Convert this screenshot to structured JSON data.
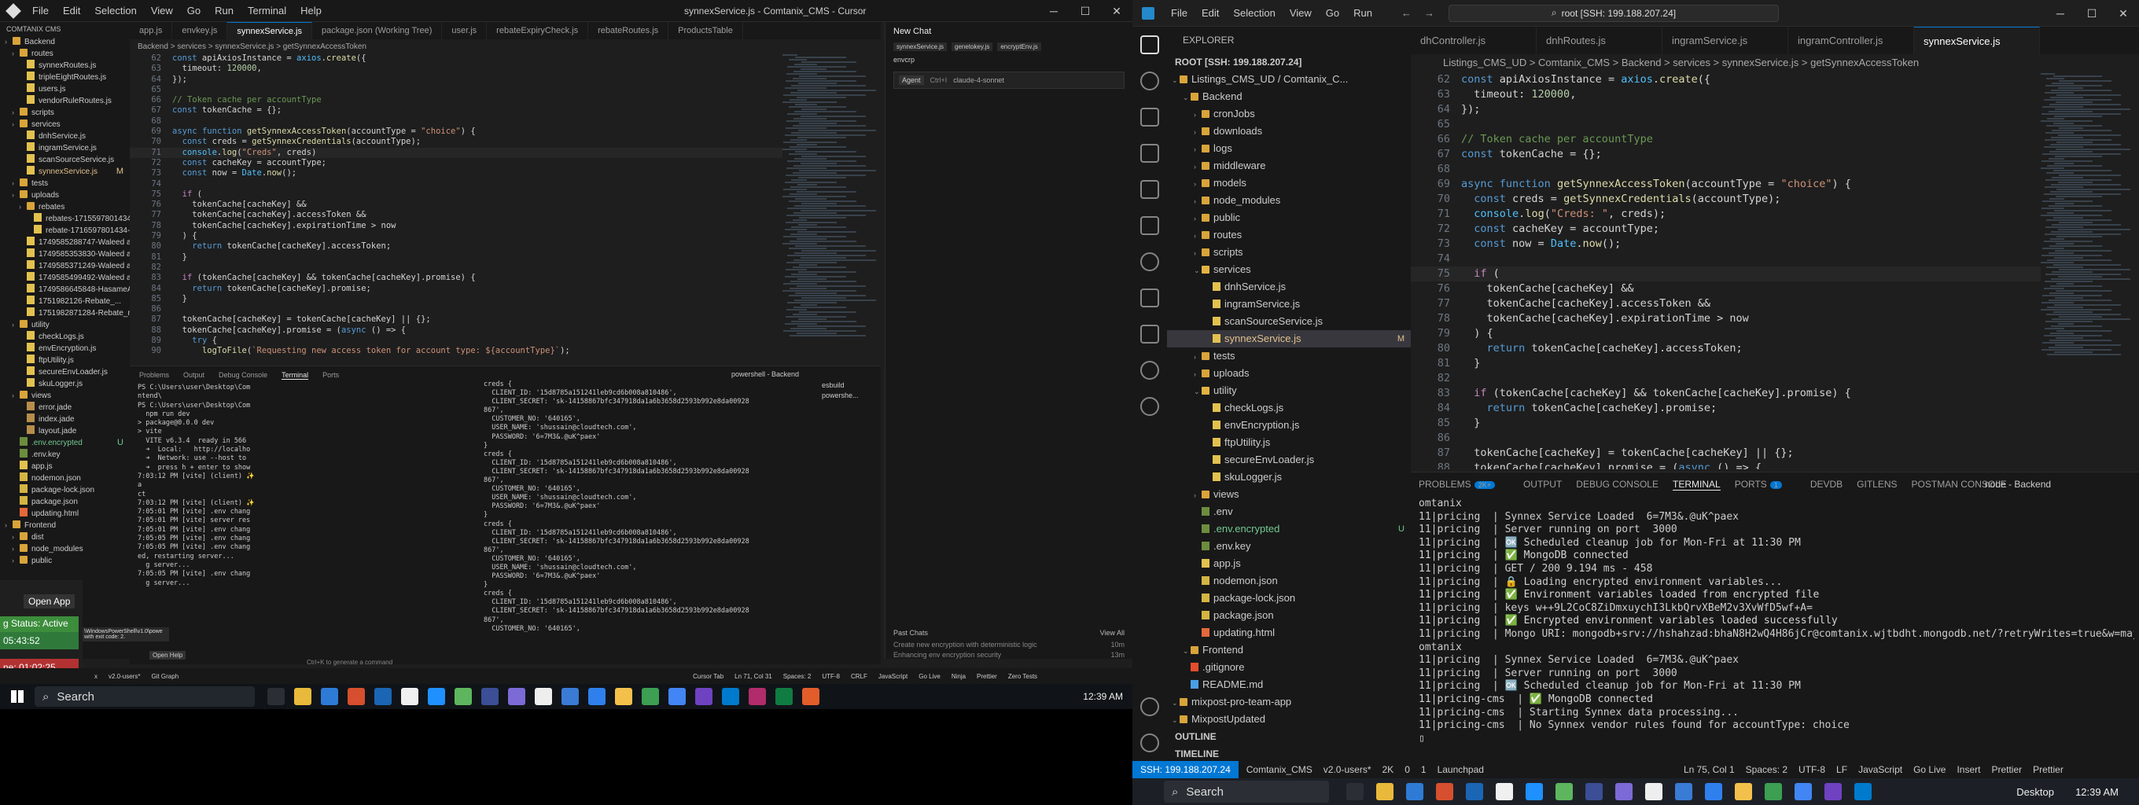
{
  "left": {
    "title": "synnexService.js - Comtanix_CMS - Cursor",
    "menu": [
      "File",
      "Edit",
      "Selection",
      "View",
      "Go",
      "Run",
      "Terminal",
      "Help"
    ],
    "explorer_title": "COMTANIX CMS",
    "tree": [
      {
        "t": "folder",
        "n": "Backend",
        "d": 0
      },
      {
        "t": "folder",
        "n": "routes",
        "d": 1
      },
      {
        "t": "file",
        "n": "synnexRoutes.js",
        "d": 2
      },
      {
        "t": "file",
        "n": "tripleEightRoutes.js",
        "d": 2
      },
      {
        "t": "file",
        "n": "users.js",
        "d": 2
      },
      {
        "t": "file",
        "n": "vendorRuleRoutes.js",
        "d": 2
      },
      {
        "t": "folder",
        "n": "scripts",
        "d": 1
      },
      {
        "t": "folder",
        "n": "services",
        "d": 1
      },
      {
        "t": "file",
        "n": "dnhService.js",
        "d": 2
      },
      {
        "t": "file",
        "n": "ingramService.js",
        "d": 2
      },
      {
        "t": "file",
        "n": "scanSourceService.js",
        "d": 2
      },
      {
        "t": "file",
        "n": "synnexService.js",
        "d": 2,
        "tag": "M"
      },
      {
        "t": "folder",
        "n": "tests",
        "d": 1
      },
      {
        "t": "folder",
        "n": "uploads",
        "d": 1
      },
      {
        "t": "folder",
        "n": "rebates",
        "d": 2
      },
      {
        "t": "file",
        "n": "rebates-1715597801434-3...",
        "d": 3
      },
      {
        "t": "file",
        "n": "rebate-1716597801434-3...",
        "d": 3
      },
      {
        "t": "file",
        "n": "1749585288747-Waleed ay...",
        "d": 2
      },
      {
        "t": "file",
        "n": "1749585353830-Waleed ay...",
        "d": 2
      },
      {
        "t": "file",
        "n": "1749585371249-Waleed ay...",
        "d": 2
      },
      {
        "t": "file",
        "n": "1749585499492-Waleed ay...",
        "d": 2
      },
      {
        "t": "file",
        "n": "1749586645848-HasameA...",
        "d": 2
      },
      {
        "t": "file",
        "n": "1751982126-Rebate_...",
        "d": 2
      },
      {
        "t": "file",
        "n": "1751982871284-Rebate_ry...",
        "d": 2
      },
      {
        "t": "folder",
        "n": "utility",
        "d": 1
      },
      {
        "t": "file",
        "n": "checkLogs.js",
        "d": 2
      },
      {
        "t": "file",
        "n": "envEncryption.js",
        "d": 2
      },
      {
        "t": "file",
        "n": "ftpUtility.js",
        "d": 2
      },
      {
        "t": "file",
        "n": "secureEnvLoader.js",
        "d": 2
      },
      {
        "t": "file",
        "n": "skuLogger.js",
        "d": 2
      },
      {
        "t": "folder",
        "n": "views",
        "d": 1
      },
      {
        "t": "file",
        "n": "error.jade",
        "d": 2
      },
      {
        "t": "file",
        "n": "index.jade",
        "d": 2
      },
      {
        "t": "file",
        "n": "layout.jade",
        "d": 2
      },
      {
        "t": "file",
        "n": ".env.encrypted",
        "d": 1,
        "tag": "U"
      },
      {
        "t": "file",
        "n": ".env.key",
        "d": 1
      },
      {
        "t": "file",
        "n": "app.js",
        "d": 1
      },
      {
        "t": "file",
        "n": "nodemon.json",
        "d": 1
      },
      {
        "t": "file",
        "n": "package-lock.json",
        "d": 1
      },
      {
        "t": "file",
        "n": "package.json",
        "d": 1
      },
      {
        "t": "file",
        "n": "updating.html",
        "d": 1
      },
      {
        "t": "folder",
        "n": "Frontend",
        "d": 0
      },
      {
        "t": "folder",
        "n": "dist",
        "d": 1
      },
      {
        "t": "folder",
        "n": "node_modules",
        "d": 1
      },
      {
        "t": "folder",
        "n": "public",
        "d": 1
      }
    ],
    "tabs": [
      "app.js",
      "envkey.js",
      "synnexService.js",
      "package.json (Working Tree)",
      "user.js",
      "rebateExpiryCheck.js",
      "rebateRoutes.js",
      "ProductsTable"
    ],
    "breadcrumb": "Backend > services > synnexService.js > getSynnexAccessToken",
    "code": [
      [
        "62",
        "const apiAxiosInstance = axios.create({"
      ],
      [
        "63",
        "  timeout: 120000,"
      ],
      [
        "64",
        "});"
      ],
      [
        "65",
        ""
      ],
      [
        "66",
        "// Token cache per accountType"
      ],
      [
        "67",
        "const tokenCache = {};"
      ],
      [
        "68",
        ""
      ],
      [
        "69",
        "async function getSynnexAccessToken(accountType = \"choice\") {"
      ],
      [
        "70",
        "  const creds = getSynnexCredentials(accountType);"
      ],
      [
        "71",
        "  console.log(\"Creds\", creds)"
      ],
      [
        "72",
        "  const cacheKey = accountType;"
      ],
      [
        "73",
        "  const now = Date.now();"
      ],
      [
        "74",
        ""
      ],
      [
        "75",
        "  if ("
      ],
      [
        "76",
        "    tokenCache[cacheKey] &&"
      ],
      [
        "77",
        "    tokenCache[cacheKey].accessToken &&"
      ],
      [
        "78",
        "    tokenCache[cacheKey].expirationTime > now"
      ],
      [
        "79",
        "  ) {"
      ],
      [
        "80",
        "    return tokenCache[cacheKey].accessToken;"
      ],
      [
        "81",
        "  }"
      ],
      [
        "82",
        ""
      ],
      [
        "83",
        "  if (tokenCache[cacheKey] && tokenCache[cacheKey].promise) {"
      ],
      [
        "84",
        "    return tokenCache[cacheKey].promise;"
      ],
      [
        "85",
        "  }"
      ],
      [
        "86",
        ""
      ],
      [
        "87",
        "  tokenCache[cacheKey] = tokenCache[cacheKey] || {};"
      ],
      [
        "88",
        "  tokenCache[cacheKey].promise = (async () => {"
      ],
      [
        "89",
        "    try {"
      ],
      [
        "90",
        "      logToFile(`Requesting new access token for account type: ${accountType}`);"
      ]
    ],
    "chat": {
      "title": "New Chat",
      "chips": [
        "synnexService.js",
        "genetokey.js",
        "encryptEnv.js"
      ],
      "file": "envcrp",
      "agent": "Agent",
      "ctrl": "Ctrl+I",
      "model": "claude-4-sonnet",
      "past_title": "Past Chats",
      "view_all": "View All",
      "past": [
        [
          "Create new encryption with deterministic logic",
          "10m"
        ],
        [
          "Enhancing env encryption security",
          "13m"
        ],
        [
          "Secure dotenv file encryption",
          "1h"
        ]
      ]
    },
    "panel_tabs": [
      "Problems",
      "Output",
      "Debug Console",
      "Terminal",
      "Ports"
    ],
    "term_name": "powershell - Backend",
    "term_side": [
      "esbuild",
      "powershe..."
    ],
    "term1": [
      "PS C:\\Users\\user\\Desktop\\Com",
      "ntend\\",
      "PS C:\\Users\\user\\Desktop\\Com",
      "  npm run dev",
      "",
      "> package@0.0.0 dev",
      "> vite",
      "",
      "",
      "  VITE v6.3.4  ready in 566",
      "",
      "  ➜  Local:   http://localho",
      "  ➜  Network: use --host to",
      "  ➜  press h + enter to show",
      "7:03:12 PM [vite] (client) ✨",
      "a",
      "ct",
      "7:03:12 PM [vite] (client) ✨",
      "7:05:01 PM [vite] .env chang",
      "7:05:01 PM [vite] server res",
      "7:05:01 PM [vite] .env chang",
      "7:05:05 PM [vite] .env chang",
      "7:05:05 PM [vite] .env chang",
      "ed, restarting server...",
      "  g server...",
      "7:05:05 PM [vite] .env chang",
      "  g server..."
    ],
    "term2": [
      "creds {",
      "  CLIENT_ID: '15d8785a151241leb9cd6b008a810486',",
      "  CLIENT_SECRET: 'sk-14158867bfc347918da1a6b3658d2593b992e8da00928",
      "867',",
      "  CUSTOMER_NO: '640165',",
      "  USER_NAME: 'shussain@cloudtech.com',",
      "  PASSWORD: '6=7M3&.@uK^paex'",
      "}",
      "creds {",
      "  CLIENT_ID: '15d8785a151241leb9cd6b008a810486',",
      "  CLIENT_SECRET: 'sk-14158867bfc347918da1a6b3658d2593b992e8da00928",
      "867',",
      "  CUSTOMER_NO: '640165',",
      "  USER_NAME: 'shussain@cloudtech.com',",
      "  PASSWORD: '6=7M3&.@uK^paex'",
      "}",
      "creds {",
      "  CLIENT_ID: '15d8785a151241leb9cd6b008a810486',",
      "  CLIENT_SECRET: 'sk-14158867bfc347918da1a6b3658d2593b992e8da00928",
      "867',",
      "  CUSTOMER_NO: '640165',",
      "  USER_NAME: 'shussain@cloudtech.com',",
      "  PASSWORD: '6=7M3&.@uK^paex'",
      "}",
      "creds {",
      "  CLIENT_ID: '15d8785a151241leb9cd6b008a810486',",
      "  CLIENT_SECRET: 'sk-14158867bfc347918da1a6b3658d2593b992e8da00928",
      "867',",
      "  CUSTOMER_NO: '640165',"
    ],
    "ctrl_k": "Ctrl+K to generate a command",
    "overlay": {
      "open_app": "Open App",
      "status": "g Status: Active",
      "time1": "05:43:52",
      "time2": "ne: 01:02:25",
      "pshell": "\\WindowsPowerShell\\v1.0\\powe with exit code: 2.",
      "open_help": "Open Help"
    },
    "status": {
      "remote": "x",
      "branch": "v2.0-users*",
      "git": "Git Graph",
      "cursor_tab": "Cursor Tab",
      "pos": "Ln 71, Col 31",
      "spaces": "Spaces: 2",
      "enc": "UTF-8",
      "eol": "CRLF",
      "lang": "JavaScript",
      "live": "Go Live",
      "ninja": "Ninja",
      "prettier": "Prettier",
      "zero": "Zero Tests"
    },
    "taskbar": {
      "search": "Search",
      "time": "12:39 AM"
    }
  },
  "right": {
    "menu": [
      "File",
      "Edit",
      "Selection",
      "View",
      "Go",
      "Run"
    ],
    "search": "root [SSH: 199.188.207.24]",
    "explorer": "EXPLORER",
    "root": "ROOT [SSH: 199.188.207.24]",
    "tree": [
      {
        "t": "folder",
        "n": "Listings_CMS_UD / Comtanix_C...",
        "d": 0
      },
      {
        "t": "folder",
        "n": "Backend",
        "d": 1
      },
      {
        "t": "folder",
        "n": "cronJobs",
        "d": 2
      },
      {
        "t": "folder",
        "n": "downloads",
        "d": 2
      },
      {
        "t": "folder",
        "n": "logs",
        "d": 2
      },
      {
        "t": "folder",
        "n": "middleware",
        "d": 2
      },
      {
        "t": "folder",
        "n": "models",
        "d": 2
      },
      {
        "t": "folder",
        "n": "node_modules",
        "d": 2
      },
      {
        "t": "folder",
        "n": "public",
        "d": 2
      },
      {
        "t": "folder",
        "n": "routes",
        "d": 2
      },
      {
        "t": "folder",
        "n": "scripts",
        "d": 2
      },
      {
        "t": "folder",
        "n": "services",
        "d": 2,
        "open": true
      },
      {
        "t": "file",
        "n": "dnhService.js",
        "d": 3
      },
      {
        "t": "file",
        "n": "ingramService.js",
        "d": 3
      },
      {
        "t": "file",
        "n": "scanSourceService.js",
        "d": 3
      },
      {
        "t": "file",
        "n": "synnexService.js",
        "d": 3,
        "tag": "M",
        "sel": true
      },
      {
        "t": "folder",
        "n": "tests",
        "d": 2
      },
      {
        "t": "folder",
        "n": "uploads",
        "d": 2
      },
      {
        "t": "folder",
        "n": "utility",
        "d": 2,
        "open": true
      },
      {
        "t": "file",
        "n": "checkLogs.js",
        "d": 3
      },
      {
        "t": "file",
        "n": "envEncryption.js",
        "d": 3
      },
      {
        "t": "file",
        "n": "ftpUtility.js",
        "d": 3
      },
      {
        "t": "file",
        "n": "secureEnvLoader.js",
        "d": 3
      },
      {
        "t": "file",
        "n": "skuLogger.js",
        "d": 3
      },
      {
        "t": "folder",
        "n": "views",
        "d": 2
      },
      {
        "t": "file",
        "n": ".env",
        "d": 2
      },
      {
        "t": "file",
        "n": ".env.encrypted",
        "d": 2,
        "tag": "U"
      },
      {
        "t": "file",
        "n": ".env.key",
        "d": 2
      },
      {
        "t": "file",
        "n": "app.js",
        "d": 2
      },
      {
        "t": "file",
        "n": "nodemon.json",
        "d": 2
      },
      {
        "t": "file",
        "n": "package-lock.json",
        "d": 2
      },
      {
        "t": "file",
        "n": "package.json",
        "d": 2
      },
      {
        "t": "file",
        "n": "updating.html",
        "d": 2
      },
      {
        "t": "folder",
        "n": "Frontend",
        "d": 1
      },
      {
        "t": "file",
        "n": ".gitignore",
        "d": 1
      },
      {
        "t": "file",
        "n": "README.md",
        "d": 1
      },
      {
        "t": "folder",
        "n": "mixpost-pro-team-app",
        "d": 0
      },
      {
        "t": "folder",
        "n": "MixpostUpdated",
        "d": 0
      }
    ],
    "outline": "OUTLINE",
    "timeline": "TIMELINE",
    "tabs": [
      "dhController.js",
      "dnhRoutes.js",
      "ingramService.js",
      "ingramController.js",
      "synnexService.js"
    ],
    "breadcrumb": "Listings_CMS_UD > Comtanix_CMS > Backend > services > synnexService.js > getSynnexAccessToken",
    "code": [
      [
        "62",
        "const apiAxiosInstance = axios.create({"
      ],
      [
        "63",
        "  timeout: 120000,"
      ],
      [
        "64",
        "});"
      ],
      [
        "65",
        ""
      ],
      [
        "66",
        "// Token cache per accountType"
      ],
      [
        "67",
        "const tokenCache = {};"
      ],
      [
        "68",
        ""
      ],
      [
        "69",
        "async function getSynnexAccessToken(accountType = \"choice\") {"
      ],
      [
        "70",
        "  const creds = getSynnexCredentials(accountType);"
      ],
      [
        "71",
        "  console.log(\"Creds: \", creds);"
      ],
      [
        "72",
        "  const cacheKey = accountType;"
      ],
      [
        "73",
        "  const now = Date.now();"
      ],
      [
        "74",
        ""
      ],
      [
        "75",
        "  if ("
      ],
      [
        "76",
        "    tokenCache[cacheKey] &&"
      ],
      [
        "77",
        "    tokenCache[cacheKey].accessToken &&"
      ],
      [
        "78",
        "    tokenCache[cacheKey].expirationTime > now"
      ],
      [
        "79",
        "  ) {"
      ],
      [
        "80",
        "    return tokenCache[cacheKey].accessToken;"
      ],
      [
        "81",
        "  }"
      ],
      [
        "82",
        ""
      ],
      [
        "83",
        "  if (tokenCache[cacheKey] && tokenCache[cacheKey].promise) {"
      ],
      [
        "84",
        "    return tokenCache[cacheKey].promise;"
      ],
      [
        "85",
        "  }"
      ],
      [
        "86",
        ""
      ],
      [
        "87",
        "  tokenCache[cacheKey] = tokenCache[cacheKey] || {};"
      ],
      [
        "88",
        "  tokenCache[cacheKey].promise = (async () => {"
      ]
    ],
    "panel_tabs": [
      "PROBLEMS",
      "OUTPUT",
      "DEBUG CONSOLE",
      "TERMINAL",
      "PORTS",
      "DEVDB",
      "GITLENS",
      "POSTMAN CONSOLE"
    ],
    "problems_badge": "2K+",
    "ports_badge": "1",
    "term_name": "node - Backend",
    "terminal": [
      "omtanix",
      "11|pricing  | Synnex Service Loaded  6=7M3&.@uK^paex",
      "11|pricing  | Server running on port  3000",
      "11|pricing  | 🆗 Scheduled cleanup job for Mon-Fri at 11:30 PM",
      "11|pricing  | ✅ MongoDB connected",
      "11|pricing  | GET / 200 9.194 ms - 458",
      "11|pricing  | 🔒 Loading encrypted environment variables...",
      "11|pricing  | ✅ Environment variables loaded from encrypted file",
      "11|pricing  | keys w++9L2CoC8ZiDmxuychI3LkbQrvXBeM2v3XvWfD5wf+A=",
      "11|pricing  | ✅ Encrypted environment variables loaded successfully",
      "11|pricing  | Mongo URI: mongodb+srv://hshahzad:bhaN8H2wQ4H86jCr@comtanix.wjtbdht.mongodb.net/?retryWrites=true&w=majority&appName=C",
      "omtanix",
      "11|pricing  | Synnex Service Loaded  6=7M3&.@uK^paex",
      "11|pricing  | Server running on port  3000",
      "11|pricing  | 🆗 Scheduled cleanup job for Mon-Fri at 11:30 PM",
      "",
      "11|pricing-cms  | ✅ MongoDB connected",
      "11|pricing-cms  | Starting Synnex data processing...",
      "11|pricing-cms  | No Synnex vendor rules found for accountType: choice",
      "▯"
    ],
    "status": {
      "ssh": "SSH: 199.188.207.24",
      "project": "Comtanix_CMS",
      "branch": "v2.0-users*",
      "errors": "2K",
      "warnings": "0",
      "info": "1",
      "launchpad": "Launchpad",
      "pos": "Ln 75, Col 1",
      "spaces": "Spaces: 2",
      "enc": "UTF-8",
      "eol": "LF",
      "lang": "JavaScript",
      "live": "Go Live",
      "insert": "Insert",
      "prettier": "Prettier",
      "prettier2": "Prettier"
    },
    "taskbar": {
      "search": "Search",
      "desktop": "Desktop",
      "time": "12:39 AM"
    }
  }
}
